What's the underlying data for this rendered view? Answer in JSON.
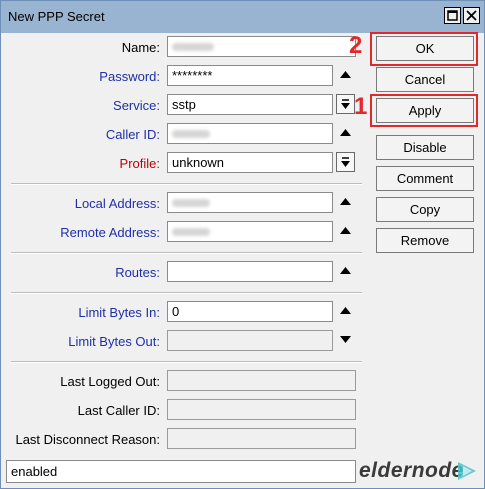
{
  "window": {
    "title": "New PPP Secret"
  },
  "fields": {
    "name": {
      "label": "Name:",
      "value": ""
    },
    "password": {
      "label": "Password:",
      "value": "********"
    },
    "service": {
      "label": "Service:",
      "value": "sstp"
    },
    "caller_id": {
      "label": "Caller ID:",
      "value": ""
    },
    "profile": {
      "label": "Profile:",
      "value": "unknown"
    },
    "local_address": {
      "label": "Local Address:",
      "value": ""
    },
    "remote_address": {
      "label": "Remote Address:",
      "value": ""
    },
    "routes": {
      "label": "Routes:",
      "value": ""
    },
    "limit_bytes_in": {
      "label": "Limit Bytes In:",
      "value": "0"
    },
    "limit_bytes_out": {
      "label": "Limit Bytes Out:",
      "value": ""
    },
    "last_logged_out": {
      "label": "Last Logged Out:",
      "value": ""
    },
    "last_caller_id": {
      "label": "Last Caller ID:",
      "value": ""
    },
    "last_disconnect_reason": {
      "label": "Last Disconnect Reason:",
      "value": ""
    }
  },
  "buttons": {
    "ok": "OK",
    "cancel": "Cancel",
    "apply": "Apply",
    "disable": "Disable",
    "comment": "Comment",
    "copy": "Copy",
    "remove": "Remove"
  },
  "annotations": {
    "ok_step": "2",
    "apply_step": "1"
  },
  "status": {
    "text": "enabled"
  },
  "watermark": {
    "text": "eldernode"
  },
  "colors": {
    "title_bar": "#99b4d1",
    "label_blue": "#1f2fa7",
    "label_red": "#c00000",
    "highlight_red": "#e0282f",
    "logo_teal": "#4dc3cb"
  },
  "icons": {
    "maximize": "maximize-icon",
    "close": "close-icon",
    "up": "triangle-up-icon",
    "down": "triangle-down-icon",
    "dropdown": "dropdown-icon"
  }
}
